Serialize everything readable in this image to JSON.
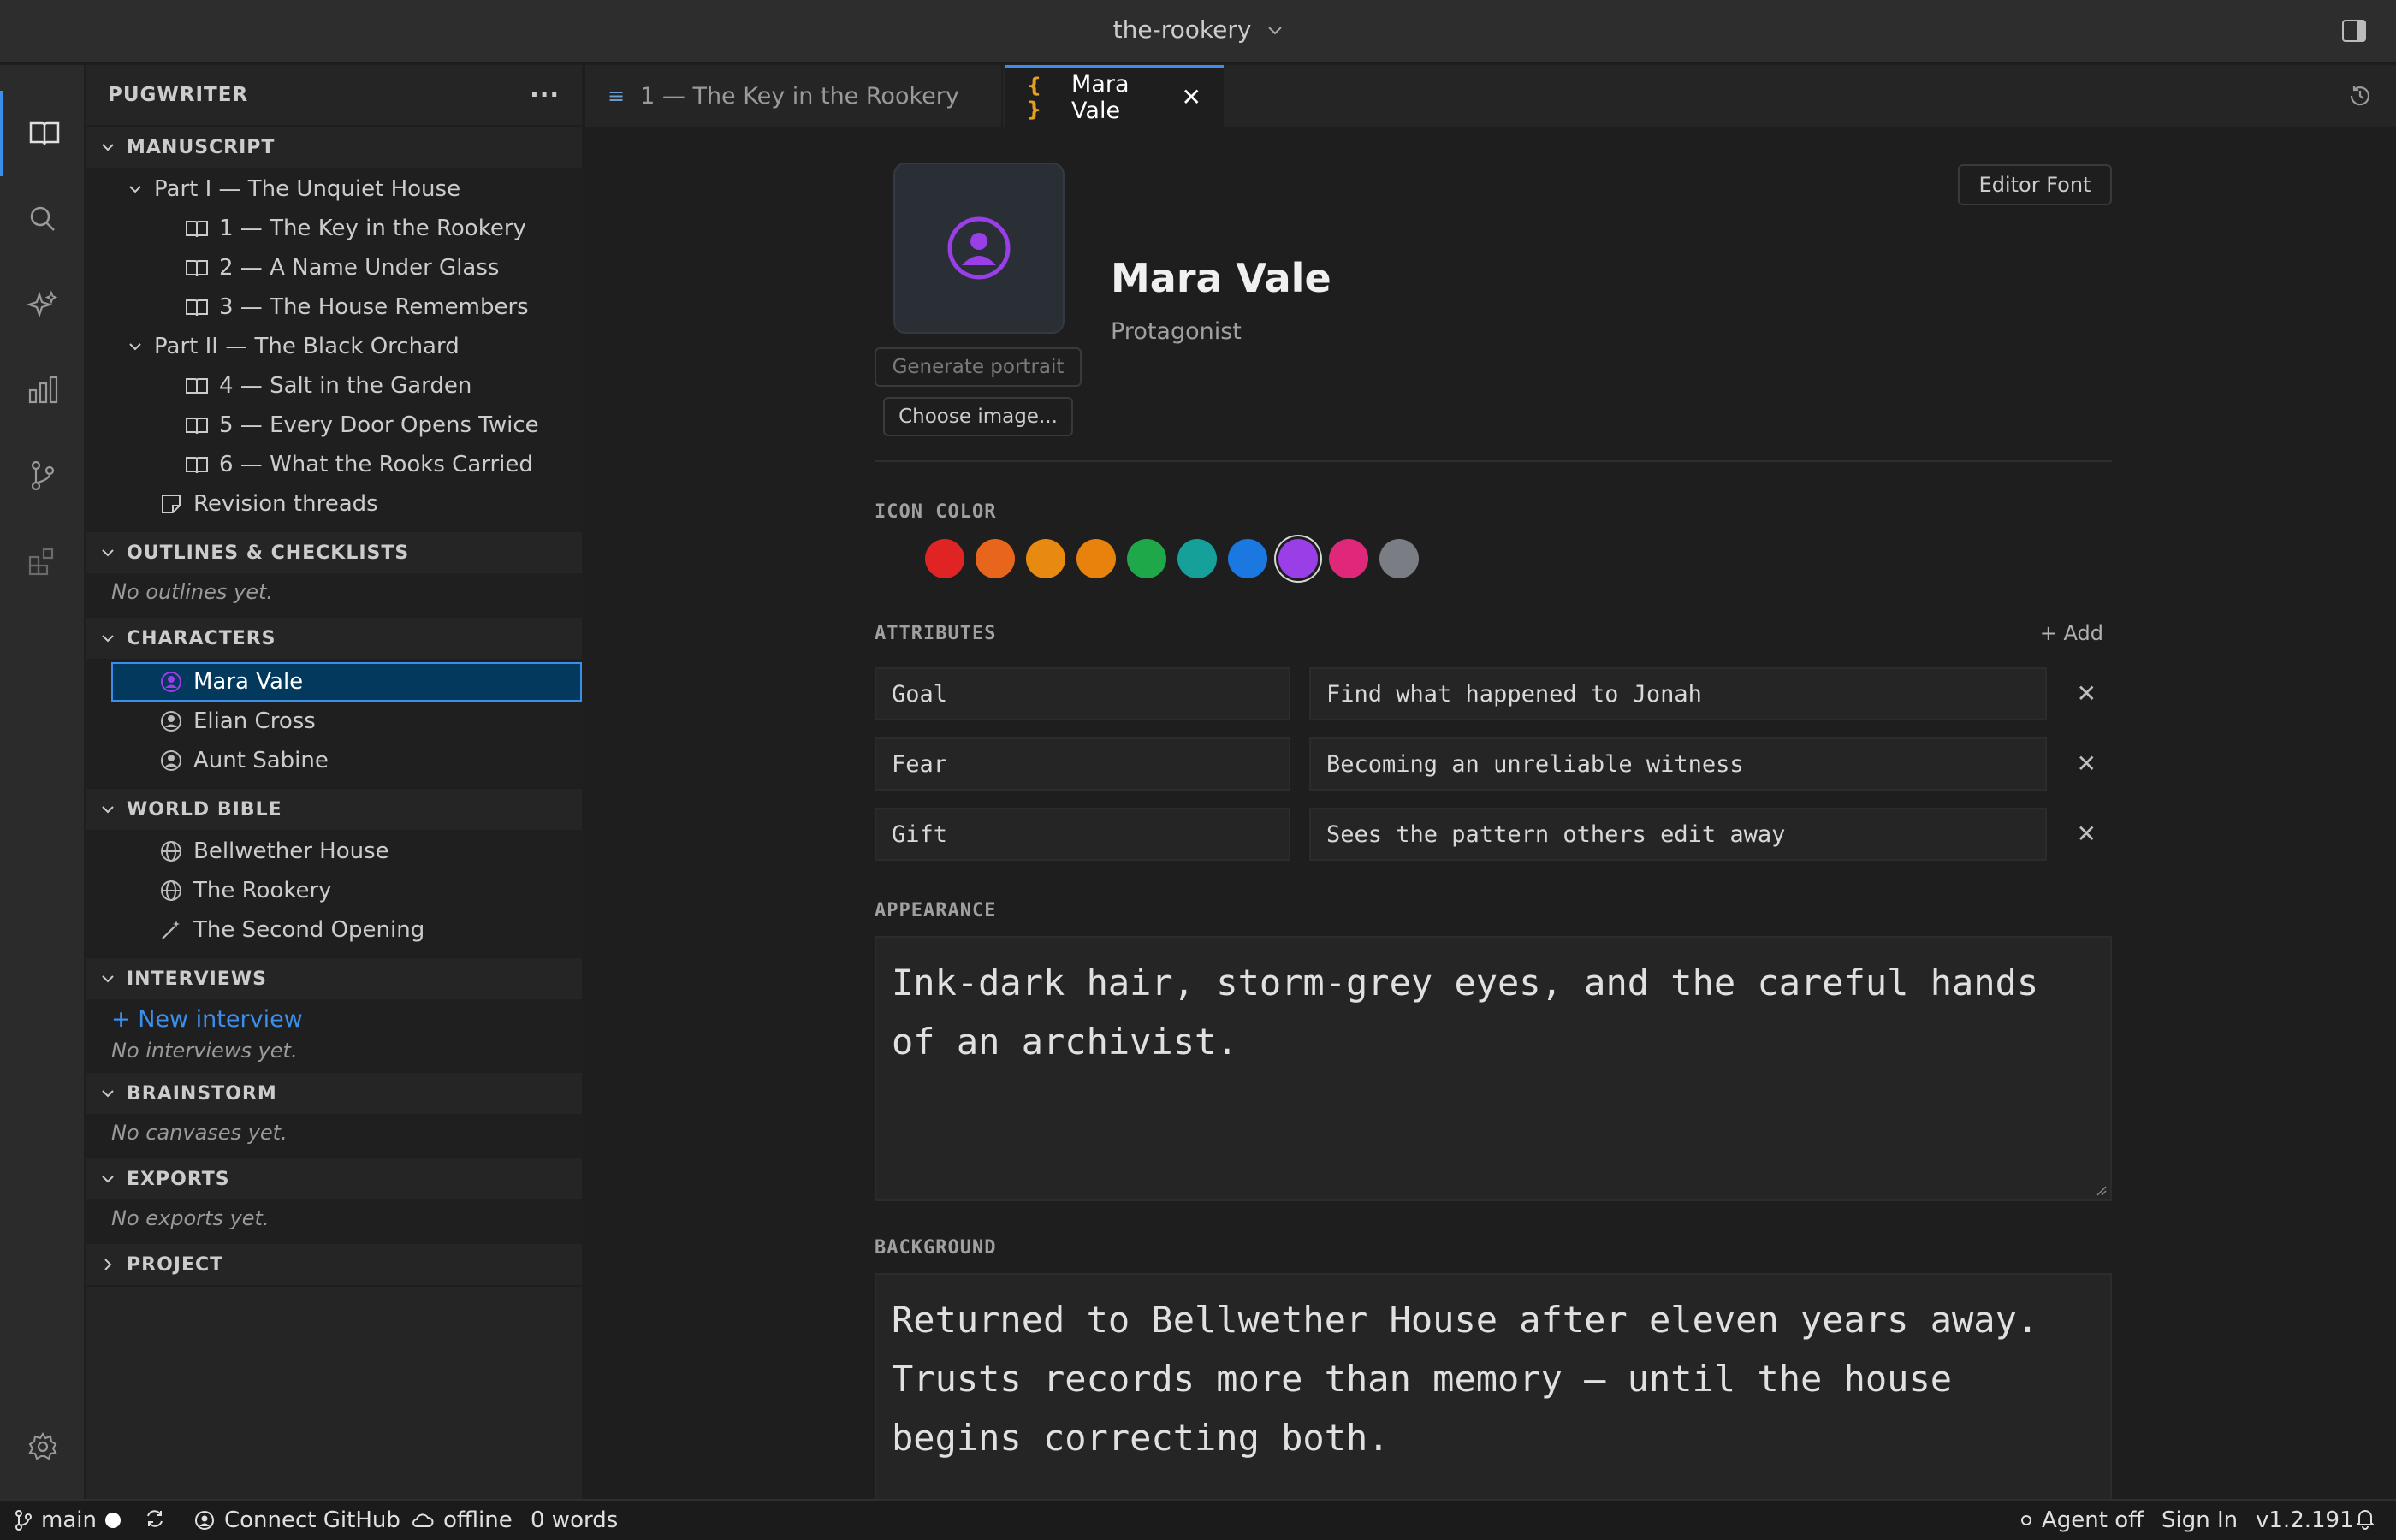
{
  "window": {
    "title": "the-rookery"
  },
  "sidebar": {
    "title": "PUGWRITER",
    "manuscript": {
      "title": "MANUSCRIPT",
      "parts": [
        {
          "label": "Part I — The Unquiet House",
          "chapters": [
            "1 — The Key in the Rookery",
            "2 — A Name Under Glass",
            "3 — The House Remembers"
          ]
        },
        {
          "label": "Part II — The Black Orchard",
          "chapters": [
            "4 — Salt in the Garden",
            "5 — Every Door Opens Twice",
            "6 — What the Rooks Carried"
          ]
        }
      ],
      "extra": "Revision threads"
    },
    "outlines": {
      "title": "OUTLINES & CHECKLISTS",
      "empty": "No outlines yet."
    },
    "characters": {
      "title": "CHARACTERS",
      "items": [
        "Mara Vale",
        "Elian Cross",
        "Aunt Sabine"
      ]
    },
    "world_bible": {
      "title": "WORLD BIBLE",
      "items": [
        "Bellwether House",
        "The Rookery",
        "The Second Opening"
      ]
    },
    "interviews": {
      "title": "INTERVIEWS",
      "new_label": "+ New interview",
      "empty": "No interviews yet."
    },
    "brainstorm": {
      "title": "BRAINSTORM",
      "empty": "No canvases yet."
    },
    "exports": {
      "title": "EXPORTS",
      "empty": "No exports yet."
    },
    "project": {
      "title": "PROJECT"
    }
  },
  "tabs": [
    {
      "label": "1 — The Key in the Rookery",
      "icon": "≡"
    },
    {
      "label": "Mara Vale",
      "icon": "{ }"
    }
  ],
  "character": {
    "name": "Mara Vale",
    "role": "Protagonist",
    "generate_portrait": "Generate portrait",
    "choose_image": "Choose image...",
    "editor_font": "Editor Font",
    "icon_color_label": "ICON COLOR",
    "swatches": [
      "#1e1e1e",
      "#e02424",
      "#e8661c",
      "#e88a10",
      "#e8820c",
      "#1fa84a",
      "#16a09a",
      "#1a78e0",
      "#9a3ee8",
      "#e0287a",
      "#7a7e84"
    ],
    "selected_swatch": 8,
    "accent_color": "#9a3ee8",
    "attributes_label": "ATTRIBUTES",
    "add_label": "+ Add",
    "attributes": [
      {
        "key": "Goal",
        "value": "Find what happened to Jonah"
      },
      {
        "key": "Fear",
        "value": "Becoming an unreliable witness"
      },
      {
        "key": "Gift",
        "value": "Sees the pattern others edit away"
      }
    ],
    "appearance_label": "APPEARANCE",
    "appearance": "Ink-dark hair, storm-grey eyes, and the careful hands of an archivist.",
    "background_label": "BACKGROUND",
    "background": "Returned to Bellwether House after eleven years away. Trusts records more than memory — until the house begins correcting both."
  },
  "statusbar": {
    "branch": "main",
    "github": "Connect GitHub",
    "connection": "offline",
    "words": "0 words",
    "agent": "Agent off",
    "sign_in": "Sign In",
    "version": "v1.2.191"
  }
}
